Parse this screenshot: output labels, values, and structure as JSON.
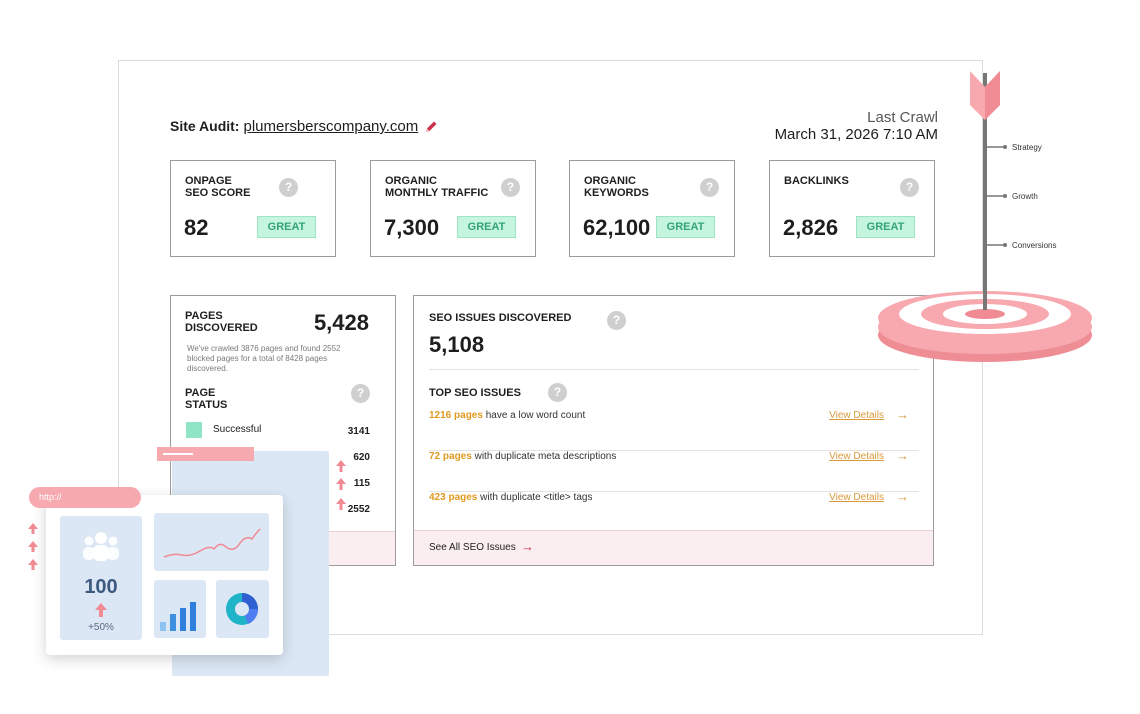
{
  "header": {
    "audit_label": "Site Audit:",
    "domain": "plumersberscompany.com",
    "last_crawl_label": "Last Crawl",
    "last_crawl_date": "March 31, 2026 7:10 AM"
  },
  "metrics": [
    {
      "label": "ONPAGE\nSEO SCORE",
      "value": "82",
      "badge": "GREAT"
    },
    {
      "label": "ORGANIC\nMONTHLY TRAFFIC",
      "value": "7,300",
      "badge": "GREAT"
    },
    {
      "label": "ORGANIC\nKEYWORDS",
      "value": "62,100",
      "badge": "GREAT"
    },
    {
      "label": "BACKLINKS",
      "value": "2,826",
      "badge": "GREAT"
    }
  ],
  "pages": {
    "title": "PAGES\nDISCOVERED",
    "value": "5,428",
    "description": "We've crawled 3876 pages and found 2552 blocked pages for a total of 8428 pages discovered.",
    "status_title": "PAGE\nSTATUS",
    "status_rows": [
      {
        "label": "Successful",
        "value": "3141"
      },
      {
        "label": "",
        "value": "620"
      },
      {
        "label": "",
        "value": "115"
      },
      {
        "label": "",
        "value": "2552"
      }
    ]
  },
  "issues": {
    "title": "SEO ISSUES DISCOVERED",
    "value": "5,108",
    "top_title": "TOP SEO ISSUES",
    "rows": [
      {
        "count": "1216 pages",
        "text": " have a low word count",
        "link": "View Details"
      },
      {
        "count": "72 pages",
        "text": " with duplicate meta descriptions",
        "link": "View Details"
      },
      {
        "count": "423 pages",
        "text": " with duplicate <title> tags",
        "link": "View Details"
      }
    ],
    "see_all": "See All SEO Issues"
  },
  "overlay": {
    "url": "http://",
    "tile_value": "100",
    "tile_pct": "+50%"
  },
  "strategy": {
    "labels": [
      "Strategy",
      "Growth",
      "Conversions"
    ]
  },
  "icons": {
    "help": "?",
    "edit": "pencil-icon",
    "arrow": "→"
  },
  "colors": {
    "badge_bg": "#c6f5df",
    "badge_text": "#34a377",
    "issue_count": "#e09a20",
    "accent_pink": "#f6aab0",
    "successful": "#8ee6c4"
  }
}
